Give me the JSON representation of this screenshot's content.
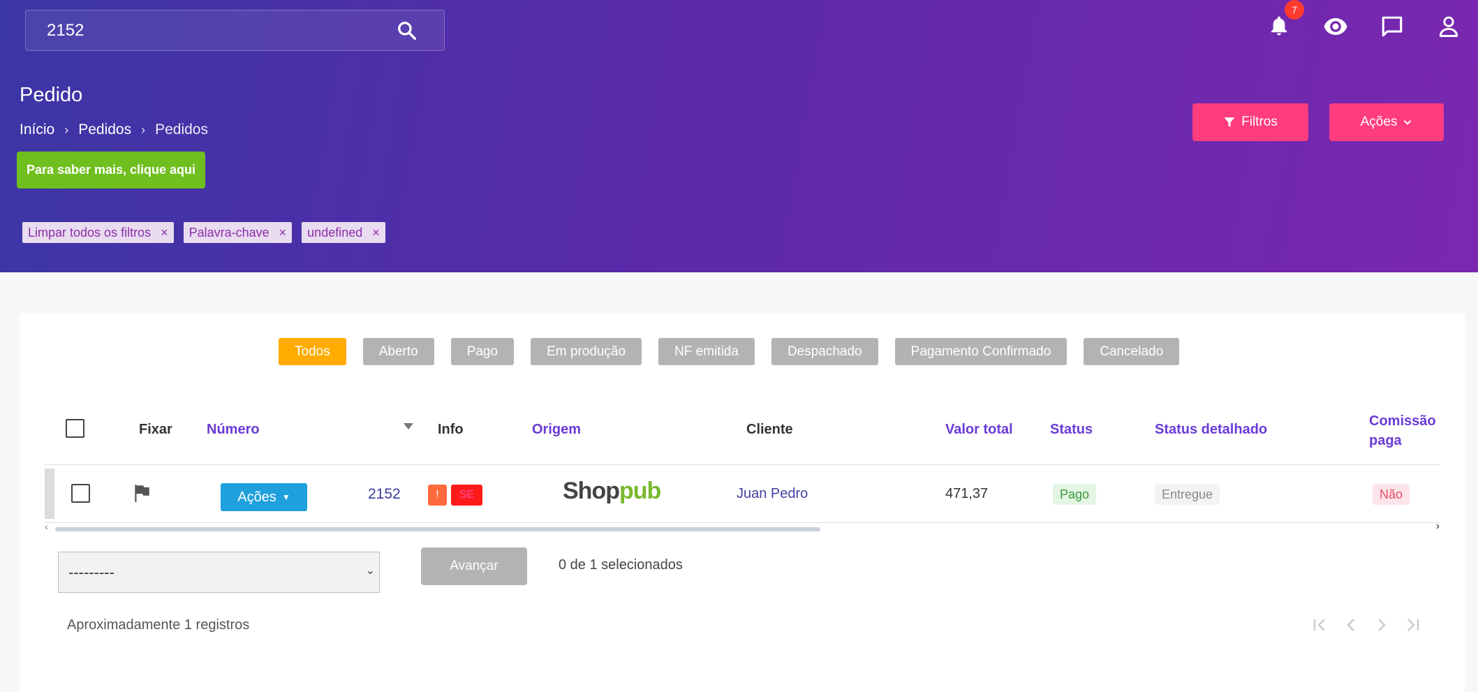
{
  "search": {
    "value": "2152",
    "icon": "search-icon"
  },
  "topbar": {
    "notifications_count": "7",
    "icons": [
      "bell-icon",
      "eye-icon",
      "chat-icon",
      "user-icon"
    ]
  },
  "page": {
    "title": "Pedido",
    "breadcrumb": [
      "Início",
      "Pedidos",
      "Pedidos"
    ],
    "help_button": "Para saber mais, clique aqui",
    "filters_button": "Filtros",
    "actions_button": "Ações"
  },
  "chips": [
    "Limpar todos os filtros",
    "Palavra-chave",
    "undefined"
  ],
  "tabs": [
    "Todos",
    "Aberto",
    "Pago",
    "Em produção",
    "NF emitida",
    "Despachado",
    "Pagamento Confirmado",
    "Cancelado"
  ],
  "table": {
    "headers": {
      "fixar": "Fixar",
      "numero": "Número",
      "info": "Info",
      "origem": "Origem",
      "cliente": "Cliente",
      "valor": "Valor total",
      "status": "Status",
      "status_detalhado": "Status detalhado",
      "comissao_1": "Comissão",
      "comissao_2": "paga"
    },
    "row": {
      "acoes": "Ações",
      "numero": "2152",
      "info_badges": [
        "!",
        "SE"
      ],
      "origem_logo": "Shoppub",
      "cliente": "Juan Pedro",
      "valor": "471,37",
      "status": "Pago",
      "status_detalhado": "Entregue",
      "comissao": "Não"
    }
  },
  "bulk": {
    "select_value": "---------",
    "advance_button": "Avançar",
    "selected_text": "0 de 1 selecionados"
  },
  "footer": {
    "records": "Aproximadamente 1 registros"
  },
  "colors": {
    "primary": "#ff3c7d",
    "tab_active": "#ffab00",
    "tab_inactive": "#b3b3b3",
    "help_green": "#6fbf1f",
    "link_purple": "#6a3bd6",
    "blue_button": "#1ea0dc"
  }
}
